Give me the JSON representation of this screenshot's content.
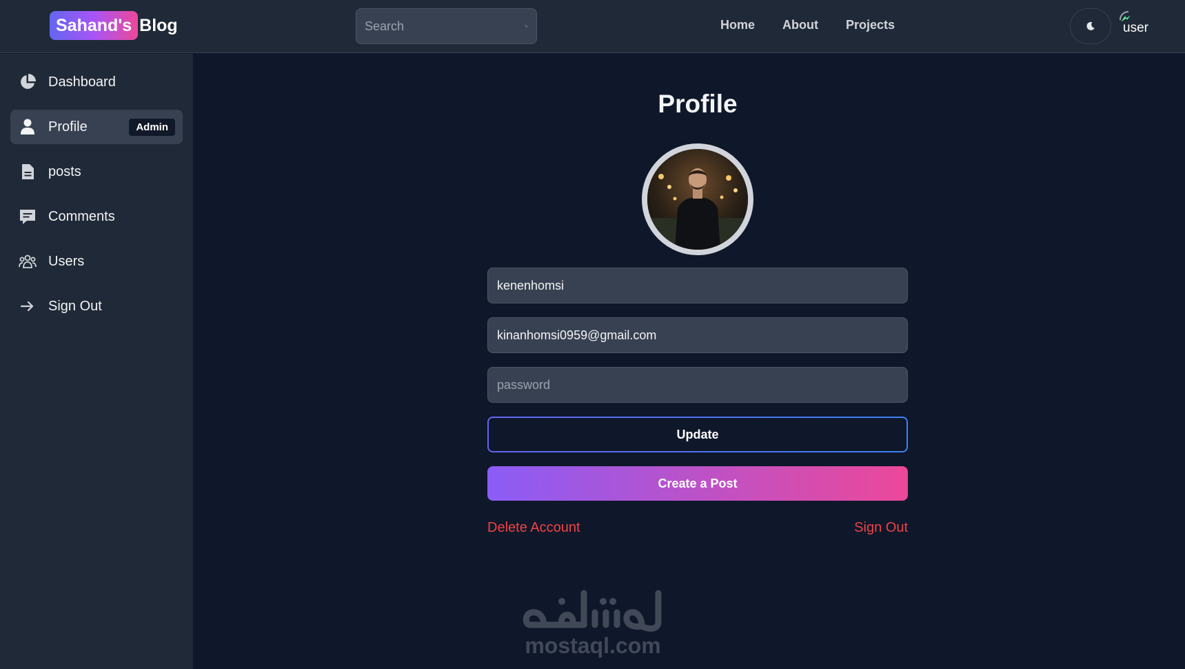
{
  "header": {
    "logo_badge": "Sahand's",
    "logo_word": "Blog",
    "search_placeholder": "Search",
    "nav": [
      "Home",
      "About",
      "Projects"
    ],
    "avatar_alt": "user"
  },
  "sidebar": {
    "items": [
      {
        "label": "Dashboard",
        "icon": "pie-chart-icon"
      },
      {
        "label": "Profile",
        "icon": "user-icon",
        "badge": "Admin",
        "active": true
      },
      {
        "label": "posts",
        "icon": "document-icon"
      },
      {
        "label": "Comments",
        "icon": "comment-icon"
      },
      {
        "label": "Users",
        "icon": "users-group-icon"
      },
      {
        "label": "Sign Out",
        "icon": "arrow-right-icon"
      }
    ]
  },
  "profile": {
    "title": "Profile",
    "username": "kenenhomsi",
    "email": "kinanhomsi0959@gmail.com",
    "password_placeholder": "password",
    "update_label": "Update",
    "create_post_label": "Create a Post",
    "delete_label": "Delete Account",
    "signout_label": "Sign Out"
  },
  "watermark": {
    "arabic": "مستقل",
    "latin": "mostaql.com"
  },
  "colors": {
    "background": "#0f172a",
    "panel": "#1f2937",
    "field": "#374151",
    "danger": "#ef4444",
    "gradient_start": "#8b5cf6",
    "gradient_end": "#ec4899"
  }
}
